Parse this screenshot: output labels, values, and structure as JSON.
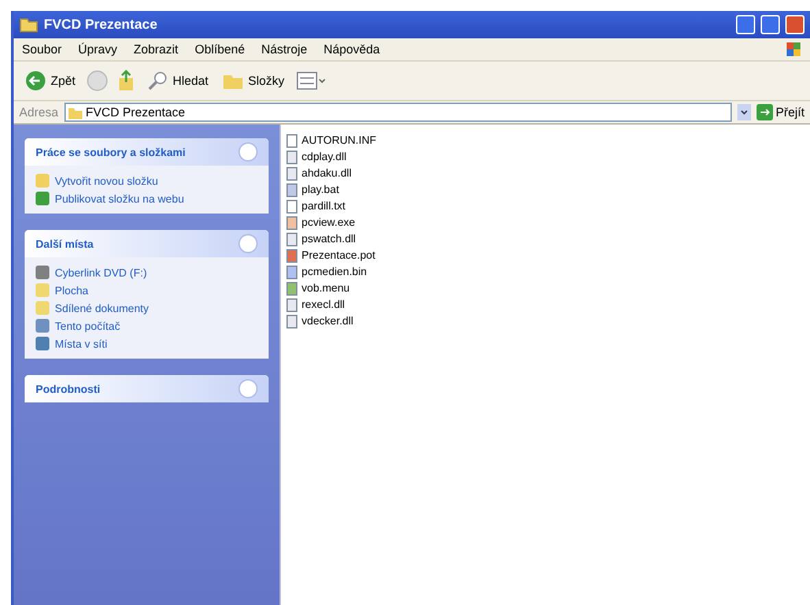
{
  "window": {
    "title": "FVCD Prezentace"
  },
  "menu": [
    "Soubor",
    "Úpravy",
    "Zobrazit",
    "Oblíbené",
    "Nástroje",
    "Nápověda"
  ],
  "toolbar": {
    "back": "Zpět",
    "search": "Hledat",
    "folders": "Složky"
  },
  "address": {
    "label": "Adresa",
    "value": "FVCD Prezentace",
    "go": "Přejít"
  },
  "sidebar": [
    {
      "title": "Práce se soubory a složkami",
      "items": [
        {
          "label": "Vytvořit novou složku",
          "kind": "newfolder"
        },
        {
          "label": "Publikovat složku na webu",
          "kind": "web"
        }
      ]
    },
    {
      "title": "Další místa",
      "items": [
        {
          "label": "Cyberlink DVD (F:)",
          "kind": "drive"
        },
        {
          "label": "Plocha",
          "kind": "folder"
        },
        {
          "label": "Sdílené dokumenty",
          "kind": "folder"
        },
        {
          "label": "Tento počítač",
          "kind": "computer"
        },
        {
          "label": "Místa v síti",
          "kind": "network"
        }
      ]
    },
    {
      "title": "Podrobnosti"
    }
  ],
  "files": [
    {
      "name": "AUTORUN.INF",
      "kind": "text"
    },
    {
      "name": "cdplay.dll",
      "kind": "dll"
    },
    {
      "name": "ahdaku.dll",
      "kind": "dll"
    },
    {
      "name": "play.bat",
      "kind": "bat"
    },
    {
      "name": "pardill.txt",
      "kind": "text"
    },
    {
      "name": "pcview.exe",
      "kind": "exe"
    },
    {
      "name": "pswatch.dll",
      "kind": "dll"
    },
    {
      "name": "Prezentace.pot",
      "kind": "ppt"
    },
    {
      "name": "pcmedien.bin",
      "kind": "bin"
    },
    {
      "name": "vob.menu",
      "kind": "menu"
    },
    {
      "name": "rexecl.dll",
      "kind": "dll"
    },
    {
      "name": "vdecker.dll",
      "kind": "dll"
    }
  ]
}
